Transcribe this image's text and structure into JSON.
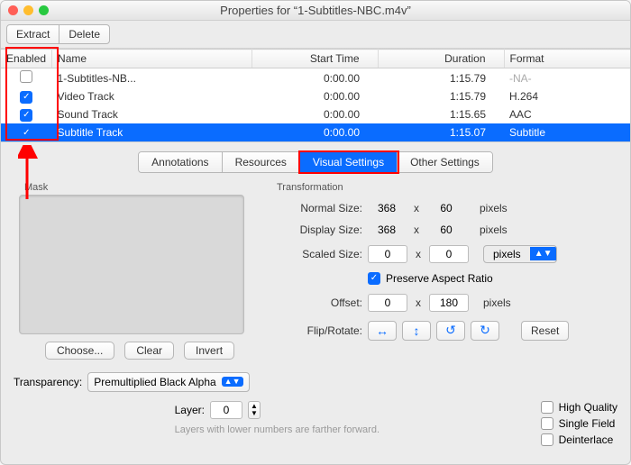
{
  "window": {
    "title": "Properties for “1-Subtitles-NBC.m4v”"
  },
  "toolbar": {
    "extract": "Extract",
    "delete": "Delete"
  },
  "columns": {
    "enabled": "Enabled",
    "name": "Name",
    "start": "Start Time",
    "duration": "Duration",
    "format": "Format"
  },
  "rows": [
    {
      "enabled": false,
      "name": "1-Subtitles-NB...",
      "start": "0:00.00",
      "duration": "1:15.79",
      "format": "-NA-",
      "na": true
    },
    {
      "enabled": true,
      "name": "Video Track",
      "start": "0:00.00",
      "duration": "1:15.79",
      "format": "H.264"
    },
    {
      "enabled": true,
      "name": "Sound Track",
      "start": "0:00.00",
      "duration": "1:15.65",
      "format": "AAC"
    },
    {
      "enabled": true,
      "name": "Subtitle Track",
      "start": "0:00.00",
      "duration": "1:15.07",
      "format": "Subtitle",
      "selected": true
    }
  ],
  "tabs": {
    "annotations": "Annotations",
    "resources": "Resources",
    "visual": "Visual Settings",
    "other": "Other Settings"
  },
  "mask": {
    "label": "Mask",
    "choose": "Choose...",
    "clear": "Clear",
    "invert": "Invert"
  },
  "transparency": {
    "label": "Transparency:",
    "value": "Premultiplied Black Alpha"
  },
  "xform": {
    "label": "Transformation",
    "normal": "Normal Size:",
    "display": "Display Size:",
    "scaled": "Scaled Size:",
    "offset": "Offset:",
    "flip": "Flip/Rotate:",
    "preserve": "Preserve Aspect Ratio",
    "x": "x",
    "pixels": "pixels",
    "normW": "368",
    "normH": "60",
    "dispW": "368",
    "dispH": "60",
    "scalW": "0",
    "scalH": "0",
    "offX": "0",
    "offY": "180",
    "unitSel": "pixels",
    "reset": "Reset"
  },
  "layer": {
    "label": "Layer:",
    "value": "0",
    "hint": "Layers with lower numbers are farther forward."
  },
  "rchecks": {
    "hq": "High Quality",
    "sf": "Single Field",
    "di": "Deinterlace"
  }
}
